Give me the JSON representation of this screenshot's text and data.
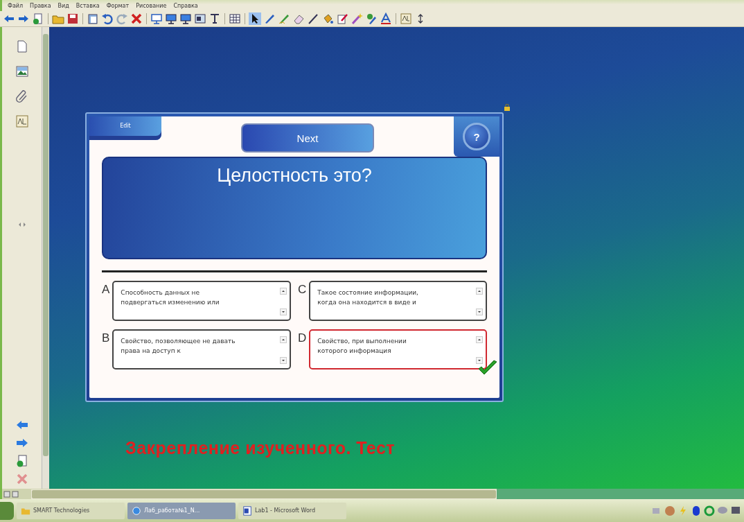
{
  "menu": [
    "Файл",
    "Правка",
    "Вид",
    "Вставка",
    "Формат",
    "Рисование",
    "Справка"
  ],
  "quiz": {
    "edit_label": "Edit",
    "next_label": "Next",
    "help_label": "?",
    "question": "Целостность это?",
    "answers": [
      {
        "letter": "A",
        "text": "Способность данных не подвергаться изменению или",
        "selected": false
      },
      {
        "letter": "C",
        "text": "Такое состояние информации, когда она находится в виде и",
        "selected": false
      },
      {
        "letter": "B",
        "text": "Свойство, позволяющее не давать права на доступ к",
        "selected": false
      },
      {
        "letter": "D",
        "text": "Свойство, при выполнении которого информация",
        "selected": true
      }
    ]
  },
  "slide_title": "Закрепление изученного. Тест",
  "taskbar": {
    "items": [
      {
        "label": "SMART Technologies",
        "kind": "folder",
        "active": false
      },
      {
        "label": "Лаб_работа№1_N...",
        "kind": "app",
        "active": true
      },
      {
        "label": "Lab1 - Microsoft Word",
        "kind": "document",
        "active": false
      }
    ]
  }
}
